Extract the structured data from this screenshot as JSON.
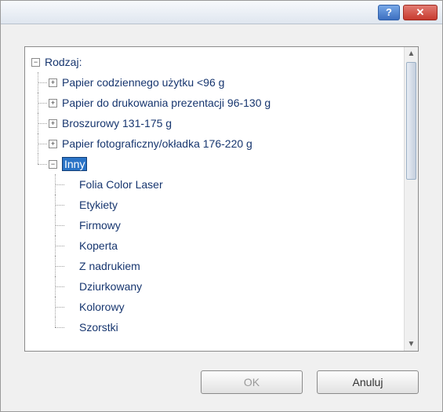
{
  "titlebar": {
    "help": "?",
    "close": "✕"
  },
  "tree": {
    "root_label": "Rodzaj:",
    "root_toggle": "−",
    "plus": "+",
    "minus": "−",
    "items": [
      {
        "label": "Papier codziennego użytku <96 g"
      },
      {
        "label": "Papier do drukowania prezentacji 96-130 g"
      },
      {
        "label": "Broszurowy 131-175 g"
      },
      {
        "label": "Papier fotograficzny/okładka 176-220 g"
      },
      {
        "label": "Inny"
      }
    ],
    "inny_children": [
      {
        "label": "Folia Color Laser"
      },
      {
        "label": "Etykiety"
      },
      {
        "label": "Firmowy"
      },
      {
        "label": "Koperta"
      },
      {
        "label": "Z nadrukiem"
      },
      {
        "label": "Dziurkowany"
      },
      {
        "label": "Kolorowy"
      },
      {
        "label": "Szorstki"
      }
    ]
  },
  "buttons": {
    "ok": "OK",
    "cancel": "Anuluj"
  },
  "scrollbar": {
    "up": "▲",
    "down": "▼"
  }
}
